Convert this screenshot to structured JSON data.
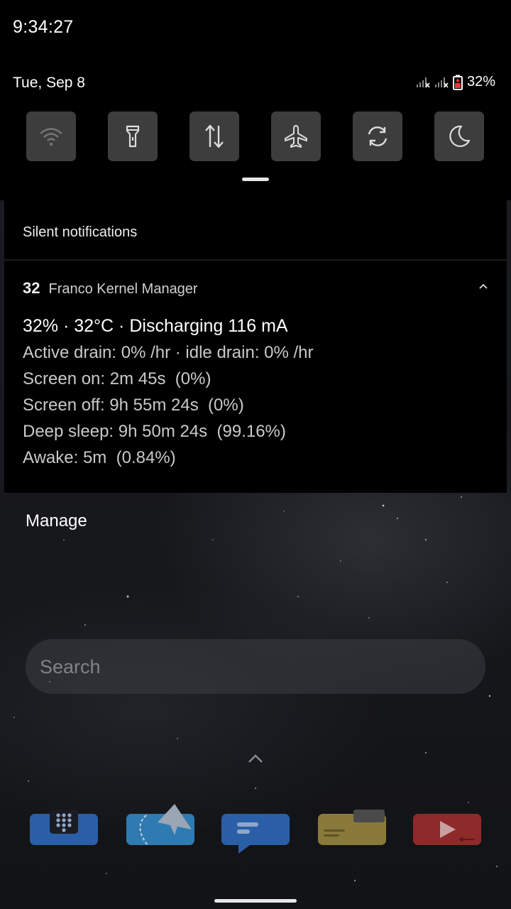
{
  "status_bar": {
    "time": "9:34:27",
    "date": "Tue, Sep 8",
    "battery_percent": "32%"
  },
  "quick_settings": {
    "tiles": [
      {
        "icon": "wifi-icon",
        "state": "off"
      },
      {
        "icon": "flashlight-icon",
        "state": "off"
      },
      {
        "icon": "mobile-data-icon",
        "state": "off"
      },
      {
        "icon": "airplane-icon",
        "state": "off"
      },
      {
        "icon": "auto-rotate-icon",
        "state": "off"
      },
      {
        "icon": "night-mode-icon",
        "state": "off"
      }
    ]
  },
  "notifications": {
    "section_title": "Silent notifications",
    "item": {
      "app_icon_text": "32",
      "app_name": "Franco Kernel Manager",
      "title": "32% · 32°C · Discharging 116 mA",
      "lines": [
        "Active drain: 0% /hr · idle drain: 0% /hr",
        "Screen on: 2m 45s  (0%)",
        "Screen off: 9h 55m 24s  (0%)",
        "Deep sleep: 9h 50m 24s  (99.16%)",
        "Awake: 5m  (0.84%)"
      ]
    },
    "manage_label": "Manage"
  },
  "home": {
    "search_placeholder": "Search",
    "dock": [
      {
        "icon": "phone-dialer-icon",
        "color": "#2a5fa8"
      },
      {
        "icon": "telegram-icon",
        "color": "#2f7ab0"
      },
      {
        "icon": "messages-icon",
        "color": "#2a5fa8"
      },
      {
        "icon": "files-icon",
        "color": "#8a7a3a"
      },
      {
        "icon": "youtube-icon",
        "color": "#8e2a2a"
      }
    ]
  },
  "colors": {
    "shade_bg": "#000000",
    "tile_bg": "#3d3d3d",
    "battery_low": "#e53935"
  }
}
